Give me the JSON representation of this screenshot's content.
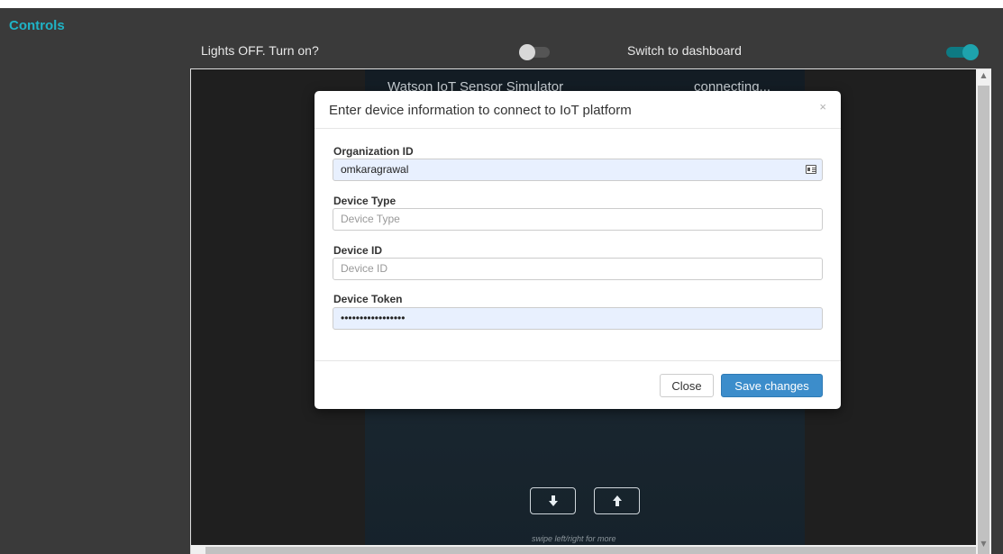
{
  "panel": {
    "title": "Controls",
    "lights_label": "Lights OFF. Turn on?",
    "lights_on": false,
    "dashboard_label": "Switch to dashboard",
    "dashboard_on": true
  },
  "phone": {
    "header_title": "Watson IoT Sensor Simulator",
    "header_status": "connecting...",
    "down_icon": "arrow-down-icon",
    "up_icon": "arrow-up-icon",
    "swipe_hint": "swipe left/right for more"
  },
  "modal": {
    "title": "Enter device information to connect to IoT platform",
    "close_symbol": "×",
    "fields": [
      {
        "label": "Organization ID",
        "value": "omkaragrawal",
        "placeholder": ""
      },
      {
        "label": "Device Type",
        "value": "",
        "placeholder": "Device Type"
      },
      {
        "label": "Device ID",
        "value": "",
        "placeholder": "Device ID"
      },
      {
        "label": "Device Token",
        "value": "•••••••••••••••••",
        "placeholder": ""
      }
    ],
    "close_button": "Close",
    "save_button": "Save changes"
  },
  "colors": {
    "accent": "#1fb3c6",
    "primary_button": "#3c8dcb",
    "panel_bg": "#3a3a3a"
  }
}
